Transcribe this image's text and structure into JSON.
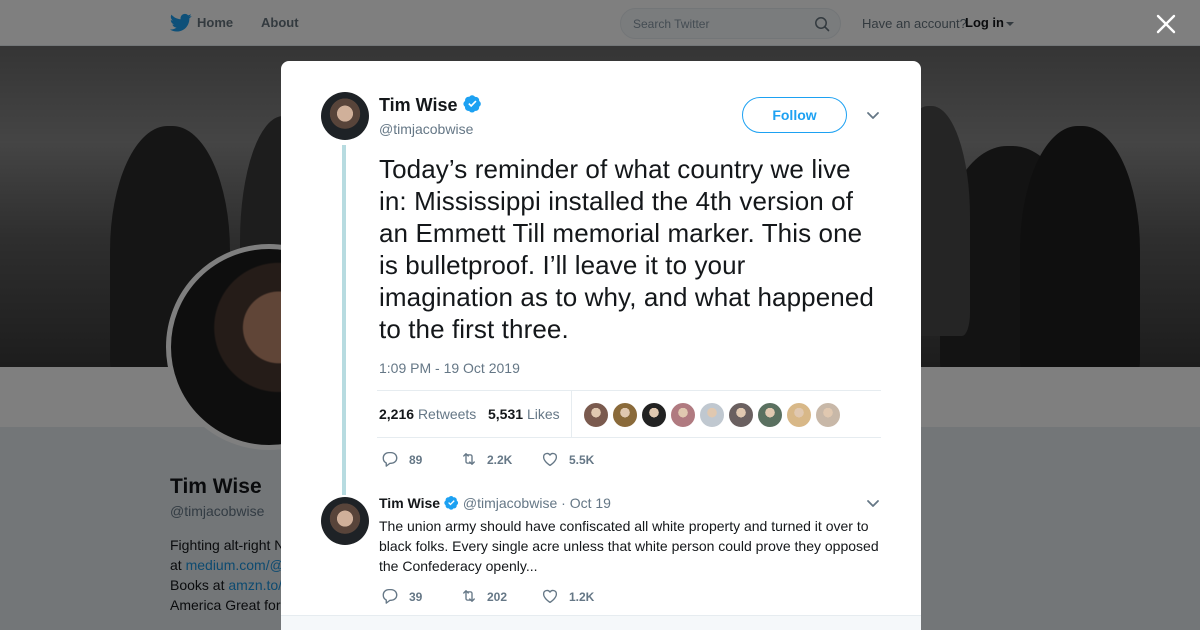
{
  "nav": {
    "home_label": "Home",
    "about_label": "About",
    "search_placeholder": "Search Twitter",
    "have_account": "Have an account?",
    "login_label": "Log in"
  },
  "profile": {
    "name": "Tim Wise",
    "handle": "@timjacobwise",
    "bio_line1": "Fighting alt-right N",
    "bio_line2_prefix": "at ",
    "bio_link1": "medium.com/@",
    "bio_line3_prefix": "Books at ",
    "bio_link2": "amzn.to/",
    "bio_line4": "America Great for"
  },
  "tweet": {
    "author_name": "Tim Wise",
    "author_handle": "@timjacobwise",
    "follow_label": "Follow",
    "text": "Today’s reminder of what country we live in: Mississippi installed the 4th version of an Emmett Till memorial marker. This one is bulletproof. I’ll leave it to your imagination as to why, and what happened to the first three.",
    "timestamp": "1:09 PM - 19 Oct 2019",
    "retweets_count": "2,216",
    "retweets_label": "Retweets",
    "likes_count": "5,531",
    "likes_label": "Likes",
    "replies": "89",
    "retweets_short": "2.2K",
    "likes_short": "5.5K",
    "liker_colors": [
      "#7a5a4e",
      "#8a6a3a",
      "#222222",
      "#b07a80",
      "#c0c8d0",
      "#6a6060",
      "#5a7060",
      "#d8b888",
      "#c8b8a8"
    ]
  },
  "reply": {
    "author_name": "Tim Wise",
    "author_handle": "@timjacobwise",
    "dot": "·",
    "date": "Oct 19",
    "text": "The union army should have confiscated all white property and turned it over to black folks. Every single acre unless that white person could prove they opposed the Confederacy openly...",
    "replies": "39",
    "retweets": "202",
    "likes": "1.2K"
  },
  "colors": {
    "accent": "#1da1f2",
    "verified": "#1da1f2",
    "thread_line": "#b7dbe0",
    "muted": "#657786"
  },
  "icons": [
    "twitter-bird-icon",
    "search-icon",
    "close-icon",
    "verified-badge-icon",
    "chevron-down-icon",
    "reply-icon",
    "retweet-icon",
    "like-icon"
  ]
}
